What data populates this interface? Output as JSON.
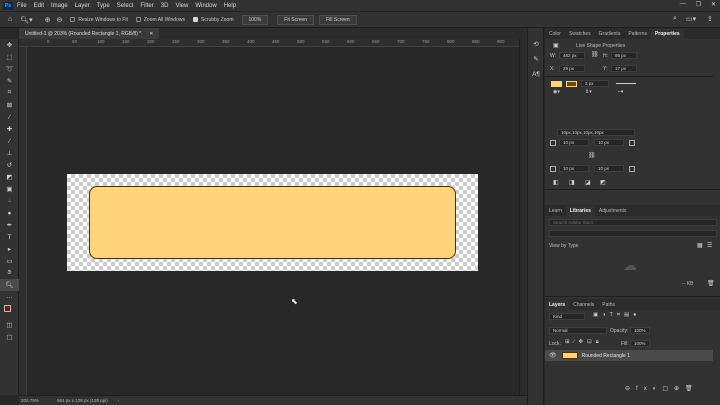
{
  "menubar": {
    "logo": "Ps",
    "items": [
      "File",
      "Edit",
      "Image",
      "Layer",
      "Type",
      "Select",
      "Filter",
      "3D",
      "View",
      "Window",
      "Help"
    ]
  },
  "options": {
    "resize_windows": "Resize Windows to Fit",
    "zoom_all": "Zoom All Windows",
    "scrubby_zoom": "Scrubby Zoom",
    "zoom_value": "100%",
    "fit_screen": "Fit Screen",
    "fill_screen": "Fill Screen"
  },
  "document": {
    "tab_title": "Untitled-1 @ 203% (Rounded Rectangle 1, RGB/8) *",
    "fill_color": "#ffd47a",
    "stroke_color": "#4b3100"
  },
  "ruler": {
    "labels": [
      "0",
      "50",
      "100",
      "150",
      "200",
      "250",
      "300",
      "350",
      "400",
      "450",
      "500",
      "550",
      "600",
      "650",
      "700",
      "750",
      "800",
      "850",
      "900",
      "950"
    ]
  },
  "status": {
    "zoom": "202.79%",
    "dims": "561 px x 128 px (128 ppi)"
  },
  "properties_panel": {
    "tabs": [
      "Color",
      "Swatches",
      "Gradients",
      "Patterns",
      "Properties"
    ],
    "active_tab": "Properties",
    "header": "Live Shape Properties",
    "w_label": "W:",
    "w": "482 px",
    "h_label": "H:",
    "h": "95 px",
    "x_label": "X:",
    "x": "29 px",
    "y_label": "Y:",
    "y": "17 px",
    "stroke_width": "2 px",
    "corners_label": "10px,10px,10px,10px",
    "tl": "10 px",
    "tr": "10 px",
    "bl": "10 px",
    "br": "10 px"
  },
  "libraries_panel": {
    "tabs": [
      "Learn",
      "Libraries",
      "Adjustments"
    ],
    "active_tab": "Libraries",
    "search_placeholder": "Search Adobe Stock",
    "view_by": "View by Type",
    "kb": "-- KB"
  },
  "layers_panel": {
    "tabs": [
      "Layers",
      "Channels",
      "Paths"
    ],
    "active_tab": "Layers",
    "kind": "Kind",
    "blend_mode": "Normal",
    "opacity_label": "Opacity:",
    "opacity": "100%",
    "lock_label": "Lock:",
    "fill_label": "Fill:",
    "fill": "100%",
    "layer_name": "Rounded Rectangle 1"
  }
}
